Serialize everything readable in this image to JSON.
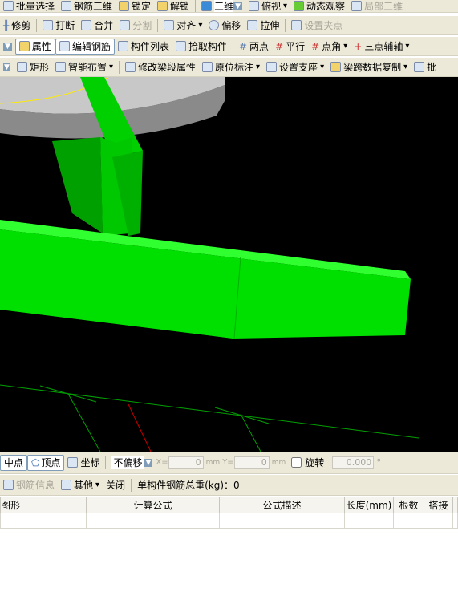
{
  "toolbar1": [
    "批量选择",
    "钢筋三维",
    "锁定",
    "解锁",
    "三维",
    "俯视",
    "动态观察",
    "局部三维"
  ],
  "toolbar2": [
    "修剪",
    "打断",
    "合并",
    "分割",
    "对齐",
    "偏移",
    "拉伸",
    "设置夹点"
  ],
  "toolbar3": [
    "属性",
    "编辑钢筋",
    "构件列表",
    "拾取构件",
    "两点",
    "平行",
    "点角",
    "三点辅轴"
  ],
  "toolbar4": [
    "矩形",
    "智能布置",
    "修改梁段属性",
    "原位标注",
    "设置支座",
    "梁跨数据复制",
    "批"
  ],
  "snapbar": {
    "midpoint": "中点",
    "vertex": "顶点",
    "coord": "坐标",
    "offset_mode": "不偏移",
    "x_label": "X=",
    "x_value": "0",
    "y_label": "Y=",
    "y_value": "0",
    "unit": "mm",
    "rotate": "旋转",
    "rotate_value": "0.000",
    "degree": "°"
  },
  "rebarbar": {
    "info": "钢筋信息",
    "other": "其他",
    "close": "关闭",
    "total_weight": "单构件钢筋总重(kg)：0"
  },
  "table": {
    "headers": [
      "图形",
      "计算公式",
      "公式描述",
      "长度(mm)",
      "根数",
      "搭接"
    ]
  },
  "colors": {
    "beam": "#00e000",
    "slab": "#c0c0c0",
    "viewport_bg": "#000000"
  }
}
